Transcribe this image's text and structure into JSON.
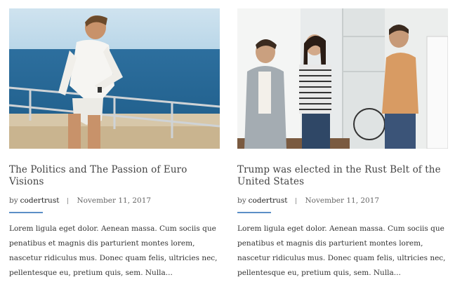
{
  "posts": [
    {
      "title": "The Politics and The Passion of Euro Visions",
      "by": "by",
      "author": "codertrust",
      "date": "November 11, 2017",
      "excerpt": "Lorem ligula eget dolor. Aenean massa. Cum sociis que penatibus et magnis dis parturient montes lorem, nascetur ridiculus mus. Donec quam felis, ultricies nec, pellentesque eu, pretium quis, sem. Nulla...",
      "image": "man-on-yacht-photo"
    },
    {
      "title": "Trump was elected in the Rust Belt of the United States",
      "by": "by",
      "author": "codertrust",
      "date": "November 11, 2017",
      "excerpt": "Lorem ligula eget dolor. Aenean massa. Cum sociis que penatibus et magnis dis parturient montes lorem, nascetur ridiculus mus. Donec quam felis, ultricies nec, pellentesque eu, pretium quis, sem. Nulla...",
      "image": "office-team-meeting-photo"
    }
  ],
  "colors": {
    "accent_rule": "#5b8fc7",
    "title_text": "#444444",
    "body_text": "#333333"
  }
}
